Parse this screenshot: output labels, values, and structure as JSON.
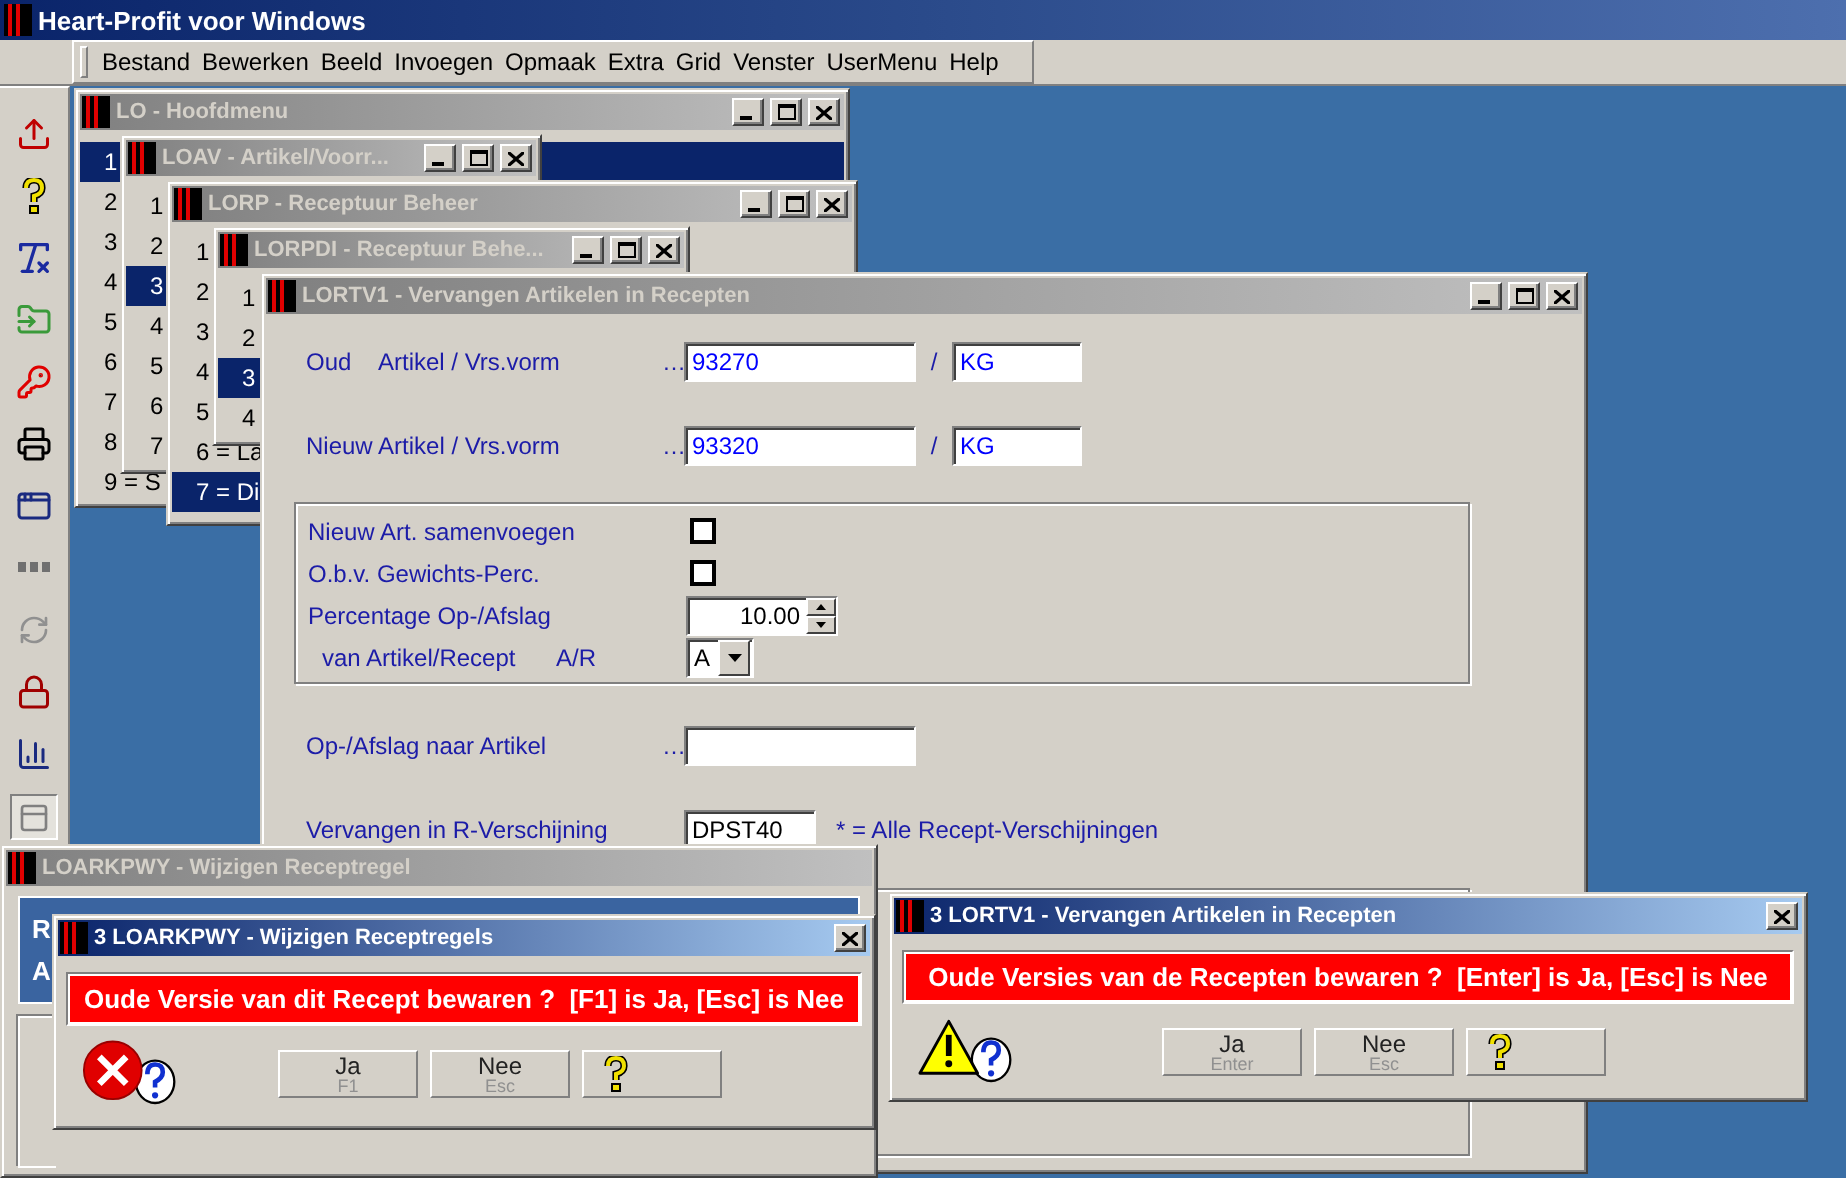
{
  "app": {
    "title": "Heart-Profit voor Windows"
  },
  "menu": [
    "Bestand",
    "Bewerken",
    "Beeld",
    "Invoegen",
    "Opmaak",
    "Extra",
    "Grid",
    "Venster",
    "UserMenu",
    "Help"
  ],
  "windows": [
    {
      "title": "LO - Hoofdmenu",
      "rows": [
        {
          "label": "1",
          "selected": true
        },
        {
          "label": "2",
          "selected": false
        },
        {
          "label": "3",
          "selected": false
        },
        {
          "label": "4",
          "selected": false
        },
        {
          "label": "5",
          "selected": false
        },
        {
          "label": "6",
          "selected": false
        },
        {
          "label": "7",
          "selected": false
        },
        {
          "label": "8",
          "selected": false
        },
        {
          "label": "9 = S",
          "selected": false
        }
      ]
    },
    {
      "title": "LOAV - Artikel/Voorr...",
      "rows": [
        {
          "label": "1",
          "selected": false
        },
        {
          "label": "2",
          "selected": false
        },
        {
          "label": "3",
          "selected": true
        },
        {
          "label": "4",
          "selected": false
        },
        {
          "label": "5",
          "selected": false
        },
        {
          "label": "6",
          "selected": false
        },
        {
          "label": "7",
          "selected": false
        }
      ]
    },
    {
      "title": "LORP - Receptuur Beheer",
      "rows": [
        {
          "label": "1",
          "selected": false
        },
        {
          "label": "2",
          "selected": false
        },
        {
          "label": "3",
          "selected": false
        },
        {
          "label": "4",
          "selected": false
        },
        {
          "label": "5",
          "selected": false
        },
        {
          "label": "6 = La",
          "selected": false
        },
        {
          "label": "7 = Di",
          "selected": true
        }
      ]
    },
    {
      "title": "LORPDI - Receptuur Behe...",
      "rows": [
        {
          "label": "1",
          "selected": false
        },
        {
          "label": "2",
          "selected": false
        },
        {
          "label": "3",
          "selected": true
        },
        {
          "label": "4",
          "selected": false
        }
      ]
    }
  ],
  "form_window": {
    "title": "LORTV1 - Vervangen Artikelen in Recepten",
    "articles": [
      {
        "prefix": "Oud",
        "label": "Artikel / Vrs.vorm",
        "dots": "…",
        "article": "93270",
        "slash": "/",
        "unit": "KG"
      },
      {
        "label": "Nieuw Artikel / Vrs.vorm",
        "dots": "…",
        "article": "93320",
        "slash": "/",
        "unit": "KG"
      }
    ],
    "options": [
      {
        "kind": "checkbox",
        "label": "Nieuw Art. samenvoegen",
        "checked": false
      },
      {
        "kind": "checkbox",
        "label": "O.b.v. Gewichts-Perc.",
        "checked": false
      },
      {
        "kind": "spin",
        "label": "Percentage Op-/Afslag",
        "value": "10.00"
      },
      {
        "kind": "select",
        "label": "van Artikel/Recept",
        "hint": "A/R",
        "value": "A"
      }
    ],
    "surcharge": {
      "label": "Op-/Afslag naar Artikel",
      "dots": "…"
    },
    "version": {
      "label": "Vervangen in R-Verschĳning",
      "value": "DPST40",
      "note": "* = Alle Recept-Verschijningen"
    }
  },
  "back_window": {
    "title": "LOARKPWY - Wijzigen Receptregel",
    "panel_lines": [
      "R",
      "A"
    ]
  },
  "dialogs": [
    {
      "title": "3 LOARKPWY - Wijzigen Receptregels",
      "kind": "error",
      "message": "Oude Versie van dit Recept bewaren ?  [F1] is Ja, [Esc] is Nee",
      "buttons": [
        {
          "kind": "choice",
          "label": "Ja",
          "key": "F1"
        },
        {
          "kind": "choice",
          "label": "Nee",
          "key": "Esc"
        },
        {
          "kind": "help"
        }
      ]
    },
    {
      "title": "3 LORTV1 - Vervangen Artikelen in Recepten",
      "kind": "warning",
      "message": "Oude Versies van de Recepten bewaren ?  [Enter] is Ja, [Esc] is Nee",
      "buttons": [
        {
          "kind": "choice",
          "label": "Ja",
          "key": "Enter"
        },
        {
          "kind": "choice",
          "label": "Nee",
          "key": "Esc"
        },
        {
          "kind": "help"
        }
      ]
    }
  ]
}
